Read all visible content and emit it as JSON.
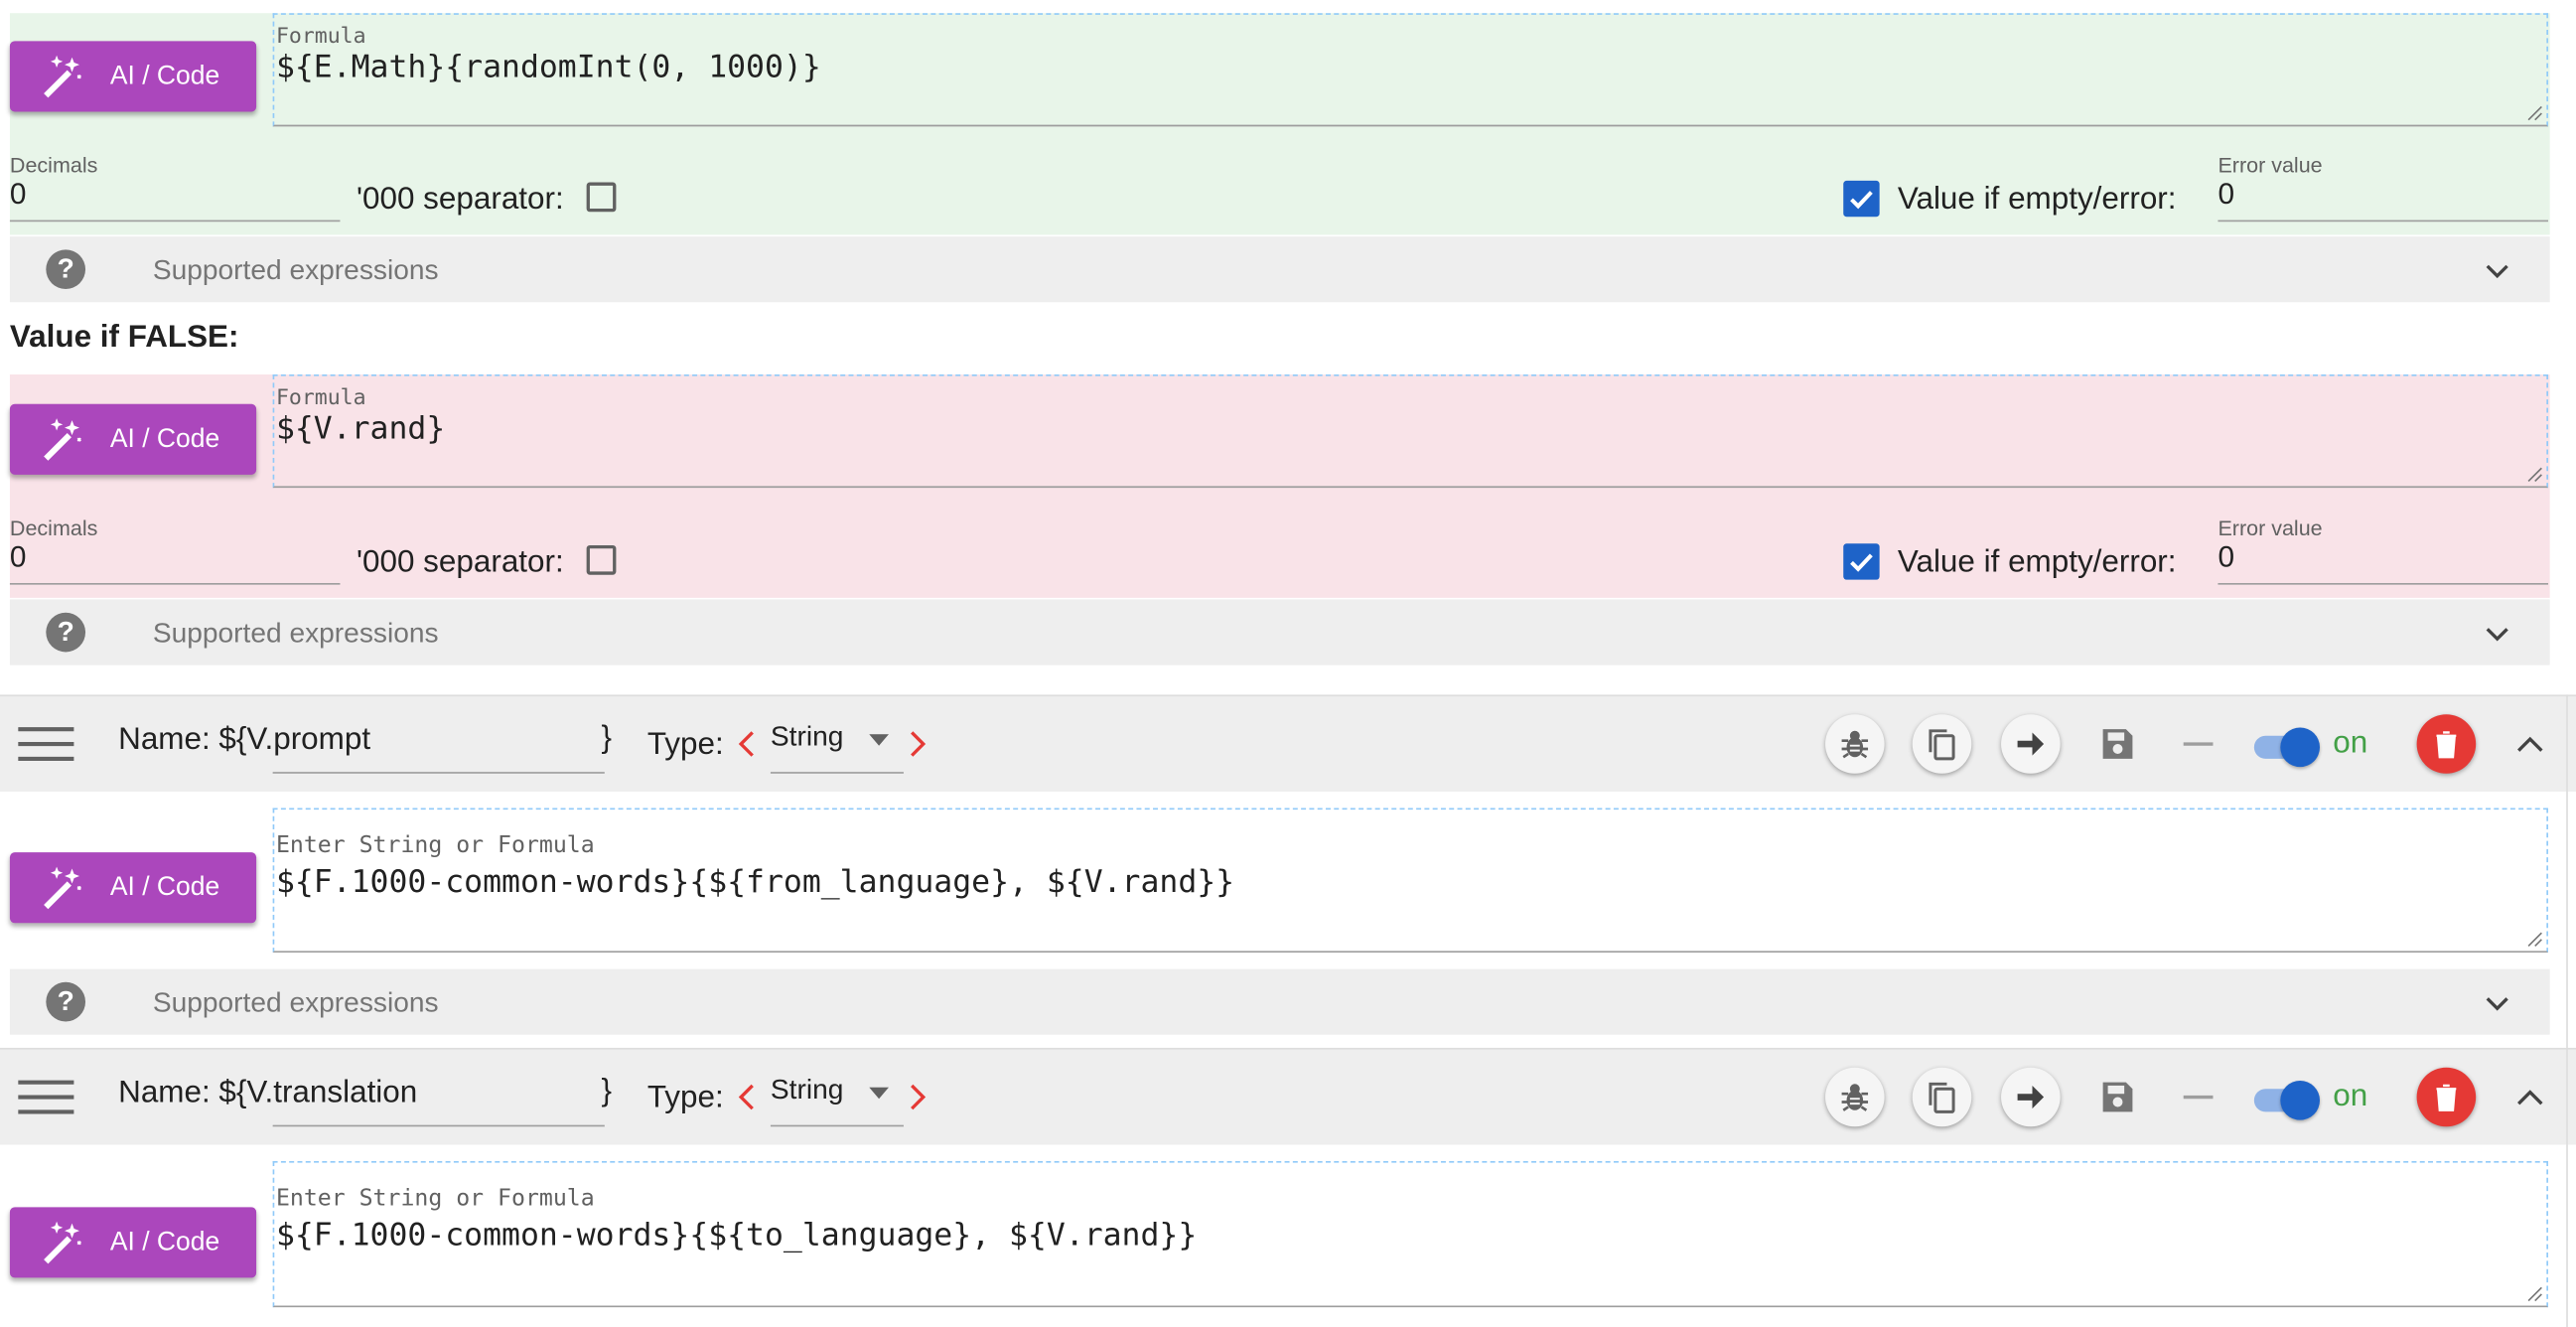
{
  "true_block": {
    "ai_button": "AI / Code",
    "formula_label": "Formula",
    "formula_value": "${E.Math}{randomInt(0, 1000)}",
    "decimals_label": "Decimals",
    "decimals_value": "0",
    "separator_label": "'000 separator:",
    "separator_checked": false,
    "empty_label": "Value if empty/error:",
    "empty_checked": true,
    "error_label": "Error value",
    "error_value": "0",
    "help_text": "Supported expressions",
    "background": "#e8f5e9"
  },
  "false_section_label": "Value if FALSE:",
  "false_block": {
    "ai_button": "AI / Code",
    "formula_label": "Formula",
    "formula_value": "${V.rand}",
    "decimals_label": "Decimals",
    "decimals_value": "0",
    "separator_label": "'000 separator:",
    "separator_checked": false,
    "empty_label": "Value if empty/error:",
    "empty_checked": true,
    "error_label": "Error value",
    "error_value": "0",
    "help_text": "Supported expressions",
    "background": "#f9e3e8"
  },
  "variables": [
    {
      "name_prefix": "Name: ${",
      "name_value": "V.prompt",
      "name_suffix": "}",
      "type_label": "Type:",
      "type_value": "String",
      "enabled": true,
      "on_label": "on",
      "ai_button": "AI / Code",
      "input_label": "Enter String or Formula",
      "input_value": "${F.1000-common-words}{${from_language}, ${V.rand}}",
      "help_text": "Supported expressions"
    },
    {
      "name_prefix": "Name: ${",
      "name_value": "V.translation",
      "name_suffix": "}",
      "type_label": "Type:",
      "type_value": "String",
      "enabled": true,
      "on_label": "on",
      "ai_button": "AI / Code",
      "input_label": "Enter String or Formula",
      "input_value": "${F.1000-common-words}{${to_language}, ${V.rand}}"
    }
  ],
  "colors": {
    "ai_button": "#ab47bc",
    "accent_blue": "#1e63c8",
    "delete_red": "#e53935",
    "arrow_red": "#e53935",
    "on_green": "#43a047"
  },
  "icons": [
    "magic-wand-icon",
    "help-icon",
    "chevron-down-icon",
    "menu-icon",
    "bug-icon",
    "copy-icon",
    "arrow-right-icon",
    "save-icon",
    "minus-icon",
    "trash-icon",
    "chevron-up-icon"
  ]
}
